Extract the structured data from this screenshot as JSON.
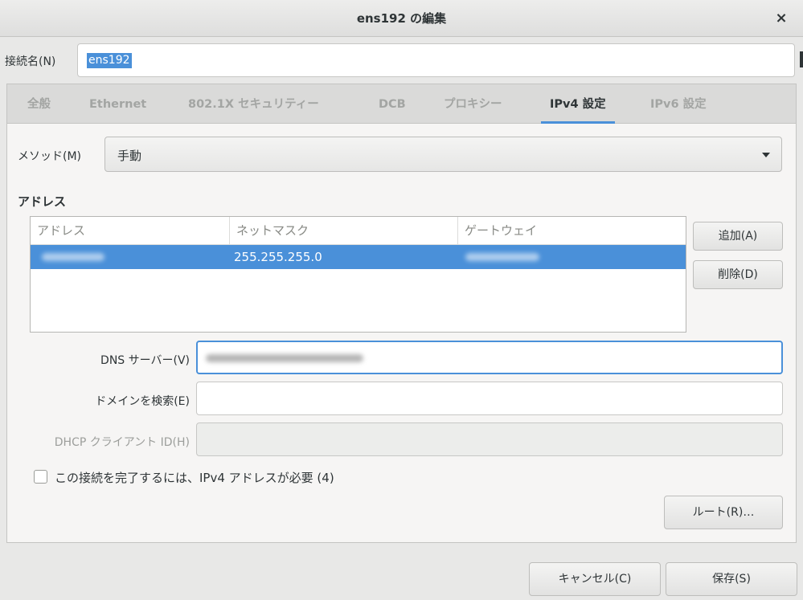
{
  "window": {
    "title": "ens192 の編集",
    "close_glyph": "×",
    "close_icon": "close-icon"
  },
  "connection": {
    "label": "接続名(N)",
    "value": "ens192"
  },
  "tabs": [
    {
      "label": "全般",
      "active": false
    },
    {
      "label": "Ethernet",
      "active": false
    },
    {
      "label": "802.1X セキュリティー",
      "active": false
    },
    {
      "label": "DCB",
      "active": false
    },
    {
      "label": "プロキシー",
      "active": false
    },
    {
      "label": "IPv4 設定",
      "active": true
    },
    {
      "label": "IPv6 設定",
      "active": false
    }
  ],
  "method": {
    "label": "メソッド(M)",
    "value": "手動",
    "icon": "chevron-down-icon"
  },
  "addresses": {
    "section_title": "アドレス",
    "columns": [
      "アドレス",
      "ネットマスク",
      "ゲートウェイ"
    ],
    "rows": [
      {
        "address": "",
        "netmask": "255.255.255.0",
        "gateway": "",
        "selected": true
      }
    ],
    "add_label": "追加(A)",
    "delete_label": "削除(D)"
  },
  "dns": {
    "label": "DNS サーバー(V)",
    "value": ""
  },
  "search_domains": {
    "label": "ドメインを検索(E)",
    "value": ""
  },
  "dhcp_client_id": {
    "label": "DHCP クライアント ID(H)",
    "value": "",
    "disabled": true
  },
  "require_ipv4": {
    "label": "この接続を完了するには、IPv4 アドレスが必要 (4)",
    "checked": false
  },
  "routes_label": "ルート(R)…",
  "footer": {
    "cancel_label": "キャンセル(C)",
    "save_label": "保存(S)"
  },
  "colors": {
    "accent": "#4a90d9",
    "text": "#2e3436",
    "disabled_text": "#9c9e9b",
    "background": "#e8e8e7"
  }
}
